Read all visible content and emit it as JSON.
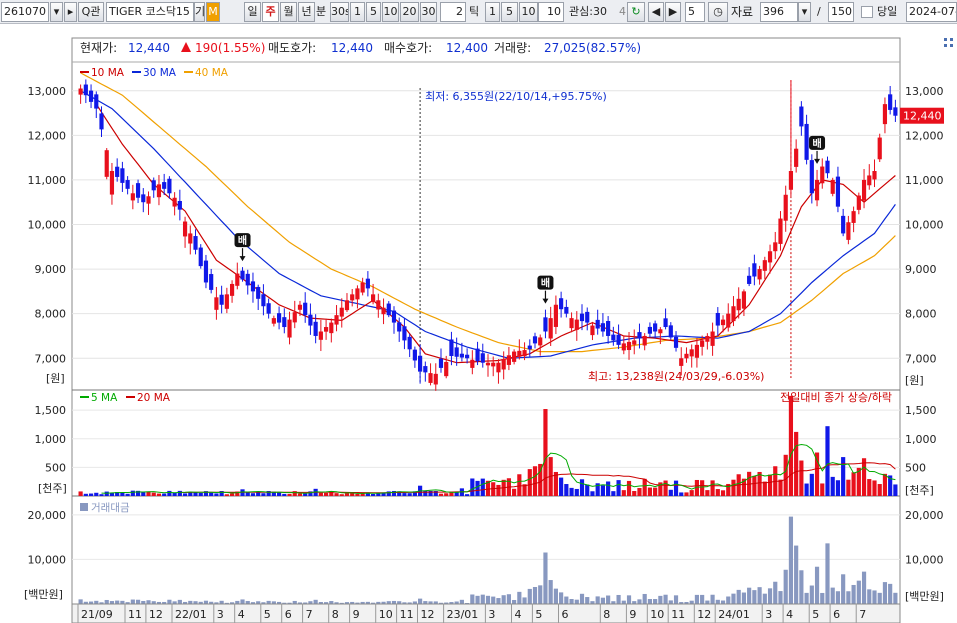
{
  "toolbar": {
    "code": "261070",
    "search_label": "Q",
    "search_suffix": "관",
    "name": "TIGER 코스닥15",
    "name_suffix": "기",
    "period_tabs": [
      "일",
      "주",
      "월",
      "년"
    ],
    "active_period": "주",
    "minute_label": "분",
    "tick_buttons": [
      "30s",
      "1",
      "5",
      "10",
      "20",
      "30"
    ],
    "tick_value": "2",
    "tick_label": "틱",
    "count_buttons": [
      "1",
      "5",
      "10"
    ],
    "count_value": "10",
    "interest_label": "관심:30",
    "interest_extra": "4",
    "step_value": "5",
    "data_label": "자료",
    "data_value": "396",
    "slash": "/",
    "total_value": "150",
    "today_label": "당일",
    "date_value": "2024-07-"
  },
  "info_bar": {
    "current_price_label": "현재가:",
    "current_price": "12,440",
    "change": "190(1.55%)",
    "ask_label": "매도호가:",
    "ask": "12,440",
    "bid_label": "매수호가:",
    "bid": "12,400",
    "volume_label": "거래량:",
    "volume": "27,025(82.57%)"
  },
  "colors": {
    "up": "#e8101c",
    "down": "#1018e8",
    "ma10": "#cc0000",
    "ma30": "#0a28d8",
    "ma40": "#f0a000",
    "vol_ma5": "#00aa00",
    "vol_ma20": "#cc0000",
    "amount": "#8898c0"
  },
  "chart_data": [
    {
      "type": "candlestick",
      "legend": [
        "10 MA",
        "30 MA",
        "40 MA"
      ],
      "y_axis_unit": "[원]",
      "y_ticks": [
        7000,
        8000,
        9000,
        10000,
        11000,
        12000,
        13000
      ],
      "y_tick_labels": [
        "7,000",
        "8,000",
        "9,000",
        "10,000",
        "11,000",
        "12,000",
        "13,000"
      ],
      "ylim": [
        6400,
        13600
      ],
      "last_price_label": "12,440",
      "annotations": [
        {
          "text": "최저: 6,355원(22/10/14,+95.75%)",
          "index": 65
        },
        {
          "text": "최고: 13,238원(24/03/29,-6.03%)",
          "index": 136
        }
      ],
      "markers": [
        {
          "text": "배",
          "index": 31
        },
        {
          "text": "배",
          "index": 89
        },
        {
          "text": "배",
          "index": 141
        }
      ],
      "anchors": [
        [
          0,
          13050
        ],
        [
          3,
          12600
        ],
        [
          6,
          11200
        ],
        [
          9,
          10800
        ],
        [
          12,
          10500
        ],
        [
          15,
          10900
        ],
        [
          18,
          10600
        ],
        [
          21,
          9800
        ],
        [
          24,
          8700
        ],
        [
          27,
          8200
        ],
        [
          30,
          8900
        ],
        [
          33,
          8500
        ],
        [
          36,
          8000
        ],
        [
          39,
          7700
        ],
        [
          42,
          8200
        ],
        [
          45,
          7500
        ],
        [
          48,
          7800
        ],
        [
          51,
          8300
        ],
        [
          54,
          8700
        ],
        [
          57,
          8300
        ],
        [
          60,
          7800
        ],
        [
          63,
          7200
        ],
        [
          65,
          6700
        ],
        [
          68,
          6650
        ],
        [
          71,
          7050
        ],
        [
          74,
          7000
        ],
        [
          77,
          6900
        ],
        [
          80,
          6900
        ],
        [
          83,
          7150
        ],
        [
          86,
          7200
        ],
        [
          89,
          7600
        ],
        [
          91,
          8200
        ],
        [
          94,
          7900
        ],
        [
          97,
          7800
        ],
        [
          100,
          7600
        ],
        [
          103,
          7300
        ],
        [
          106,
          7400
        ],
        [
          109,
          7550
        ],
        [
          112,
          7700
        ],
        [
          115,
          7000
        ],
        [
          118,
          7300
        ],
        [
          121,
          7600
        ],
        [
          124,
          8000
        ],
        [
          127,
          8500
        ],
        [
          130,
          9000
        ],
        [
          133,
          9600
        ],
        [
          136,
          11200
        ],
        [
          138,
          12200
        ],
        [
          140,
          10700
        ],
        [
          142,
          11300
        ],
        [
          144,
          11000
        ],
        [
          146,
          9800
        ],
        [
          148,
          10300
        ],
        [
          150,
          11000
        ],
        [
          152,
          11200
        ],
        [
          154,
          12700
        ],
        [
          156,
          12440
        ]
      ],
      "ma10_anchors": [
        [
          3,
          12700
        ],
        [
          8,
          11800
        ],
        [
          14,
          10900
        ],
        [
          20,
          10300
        ],
        [
          26,
          9200
        ],
        [
          32,
          8700
        ],
        [
          38,
          8200
        ],
        [
          44,
          7900
        ],
        [
          50,
          7850
        ],
        [
          56,
          8300
        ],
        [
          62,
          7700
        ],
        [
          66,
          7100
        ],
        [
          72,
          6900
        ],
        [
          80,
          6950
        ],
        [
          86,
          7100
        ],
        [
          92,
          7500
        ],
        [
          98,
          7800
        ],
        [
          104,
          7500
        ],
        [
          110,
          7450
        ],
        [
          116,
          7350
        ],
        [
          122,
          7500
        ],
        [
          128,
          8200
        ],
        [
          134,
          9300
        ],
        [
          138,
          10400
        ],
        [
          142,
          11000
        ],
        [
          146,
          10900
        ],
        [
          150,
          10500
        ],
        [
          156,
          11100
        ]
      ],
      "ma30_anchors": [
        [
          0,
          13000
        ],
        [
          6,
          12600
        ],
        [
          14,
          11700
        ],
        [
          22,
          10700
        ],
        [
          30,
          9700
        ],
        [
          38,
          8900
        ],
        [
          46,
          8400
        ],
        [
          54,
          8200
        ],
        [
          60,
          8050
        ],
        [
          66,
          7600
        ],
        [
          74,
          7250
        ],
        [
          82,
          7000
        ],
        [
          90,
          7050
        ],
        [
          98,
          7300
        ],
        [
          106,
          7450
        ],
        [
          114,
          7500
        ],
        [
          122,
          7450
        ],
        [
          128,
          7600
        ],
        [
          134,
          8000
        ],
        [
          140,
          8700
        ],
        [
          146,
          9300
        ],
        [
          152,
          9800
        ],
        [
          156,
          10450
        ]
      ],
      "ma40_anchors": [
        [
          0,
          13400
        ],
        [
          8,
          12900
        ],
        [
          16,
          12100
        ],
        [
          24,
          11300
        ],
        [
          32,
          10400
        ],
        [
          40,
          9600
        ],
        [
          48,
          9000
        ],
        [
          56,
          8600
        ],
        [
          64,
          8100
        ],
        [
          72,
          7700
        ],
        [
          80,
          7350
        ],
        [
          88,
          7150
        ],
        [
          96,
          7150
        ],
        [
          104,
          7250
        ],
        [
          112,
          7400
        ],
        [
          120,
          7450
        ],
        [
          128,
          7600
        ],
        [
          134,
          7800
        ],
        [
          140,
          8300
        ],
        [
          146,
          8900
        ],
        [
          152,
          9300
        ],
        [
          156,
          9750
        ]
      ]
    },
    {
      "type": "bar",
      "legend": [
        "5 MA",
        "20 MA"
      ],
      "right_label": "전일대비 종가 상승/하락",
      "y_axis_unit": "[천주]",
      "y_ticks": [
        500,
        1000,
        1500
      ],
      "y_tick_labels": [
        "500",
        "1,000",
        "1,500"
      ],
      "ylim": [
        0,
        1800
      ],
      "spikes": [
        [
          65,
          180
        ],
        [
          84,
          380
        ],
        [
          86,
          470
        ],
        [
          87,
          520
        ],
        [
          88,
          560
        ],
        [
          89,
          1520
        ],
        [
          90,
          680
        ],
        [
          91,
          420
        ],
        [
          108,
          300
        ],
        [
          118,
          280
        ],
        [
          126,
          380
        ],
        [
          130,
          420
        ],
        [
          133,
          520
        ],
        [
          135,
          720
        ],
        [
          136,
          1750
        ],
        [
          137,
          1120
        ],
        [
          138,
          620
        ],
        [
          141,
          760
        ],
        [
          143,
          1220
        ],
        [
          146,
          680
        ],
        [
          150,
          660
        ]
      ]
    },
    {
      "type": "bar",
      "legend": [
        "거래대금"
      ],
      "y_axis_unit": "[백만원]",
      "y_ticks": [
        10000,
        20000
      ],
      "y_tick_labels": [
        "10,000",
        "20,000"
      ],
      "ylim": [
        0,
        24000
      ],
      "x_tick_labels": [
        "21/09",
        "11",
        "12",
        "22/01",
        "3",
        "4",
        "5",
        "6",
        "7",
        "8",
        "9",
        "10",
        "11",
        "12",
        "23/01",
        "3",
        "4",
        "5",
        "6",
        "8",
        "9",
        "10",
        "11",
        "12",
        "24/01",
        "3",
        "4",
        "5",
        "6",
        "7"
      ],
      "x_tick_indices": [
        0,
        9,
        13,
        18,
        26,
        30,
        35,
        39,
        43,
        48,
        52,
        57,
        61,
        65,
        70,
        78,
        83,
        87,
        92,
        100,
        105,
        109,
        113,
        118,
        122,
        131,
        135,
        140,
        144,
        149
      ]
    }
  ]
}
